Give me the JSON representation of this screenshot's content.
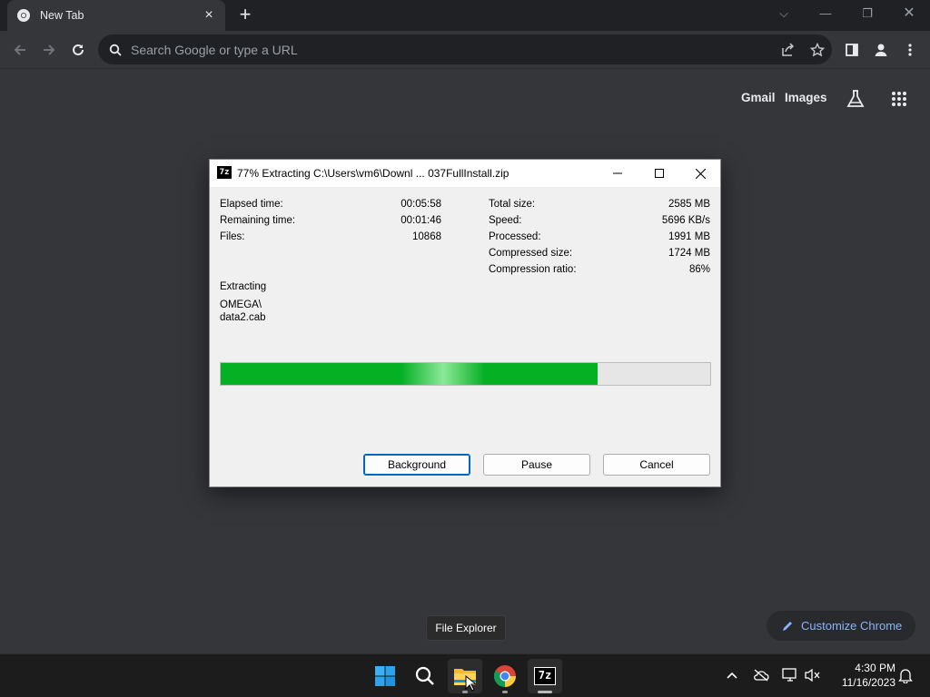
{
  "browser": {
    "tab_title": "New Tab",
    "omnibox_placeholder": "Search Google or type a URL",
    "header_links": {
      "gmail": "Gmail",
      "images": "Images"
    },
    "customize_label": "Customize Chrome"
  },
  "dialog": {
    "app_icon_text": "7z",
    "title": "77% Extracting C:\\Users\\vm6\\Downl ... 037FullInstall.zip",
    "left_stats": [
      {
        "label": "Elapsed time:",
        "value": "00:05:58"
      },
      {
        "label": "Remaining time:",
        "value": "00:01:46"
      },
      {
        "label": "Files:",
        "value": "10868"
      }
    ],
    "right_stats": [
      {
        "label": "Total size:",
        "value": "2585 MB"
      },
      {
        "label": "Speed:",
        "value": "5696 KB/s"
      },
      {
        "label": "Processed:",
        "value": "1991 MB"
      },
      {
        "label": "Compressed size:",
        "value": "1724 MB"
      },
      {
        "label": "Compression ratio:",
        "value": "86%"
      }
    ],
    "status_label": "Extracting",
    "current_folder": "OMEGA\\",
    "current_file": "data2.cab",
    "progress_percent": 77,
    "buttons": {
      "background": "Background",
      "pause": "Pause",
      "cancel": "Cancel"
    }
  },
  "tooltip": "File Explorer",
  "taskbar": {
    "pinned": [
      "start-icon",
      "search-icon",
      "file-explorer-icon",
      "chrome-icon",
      "7zip-icon"
    ],
    "sevenzip_text": "7z",
    "clock_time": "4:30 PM",
    "clock_date": "11/16/2023"
  },
  "colors": {
    "progress_green": "#06b025",
    "link_blue": "#8ab4f8",
    "chrome_bg": "#35363a"
  }
}
